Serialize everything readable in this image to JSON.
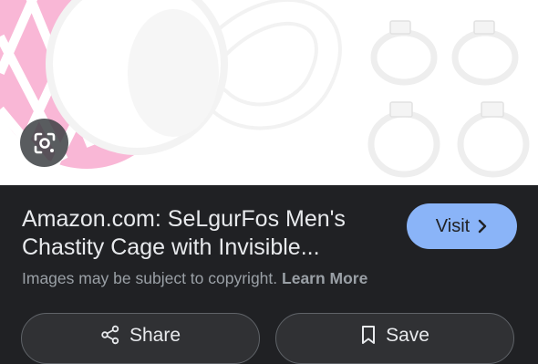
{
  "result": {
    "source": "Amazon.com",
    "title_line1": "Amazon.com: SeLgurFos Men's",
    "title_line2": "Chastity Cage with Invisible...",
    "visit_label": "Visit",
    "copyright_text": "Images may be subject to copyright.",
    "learn_more_label": "Learn More"
  },
  "actions": {
    "share_label": "Share",
    "save_label": "Save"
  },
  "icons": {
    "lens": "google-lens-icon",
    "visit_arrow": "chevron-right-icon",
    "share": "share-icon",
    "save": "bookmark-icon"
  },
  "colors": {
    "background": "#202124",
    "visit_button": "#8ab4f8",
    "accent_pink": "#f7a8cf",
    "text_primary": "#e8eaed",
    "text_secondary": "#9aa0a6"
  }
}
